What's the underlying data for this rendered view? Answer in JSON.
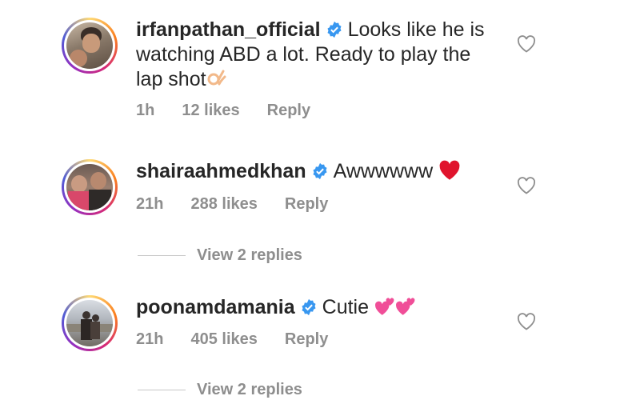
{
  "comments": [
    {
      "username": "irfanpathan_official",
      "text": "Looks like he is watching ABD a lot. Ready to play the lap shot",
      "emoji": "ok-hand-emoji",
      "time": "1h",
      "likes": "12 likes",
      "reply": "Reply"
    },
    {
      "username": "shairaahmedkhan",
      "text": "Awwwwww",
      "emoji": "red-heart-emoji",
      "time": "21h",
      "likes": "288 likes",
      "reply": "Reply",
      "view_replies": "View 2 replies"
    },
    {
      "username": "poonamdamania",
      "text": "Cutie",
      "emoji": "two-hearts-emoji",
      "time": "21h",
      "likes": "405 likes",
      "reply": "Reply",
      "view_replies": "View 2 replies"
    }
  ],
  "colors": {
    "text": "#262626",
    "meta": "#8e8e8e",
    "verified": "#3897f0",
    "heart": "#e0142d",
    "pink": "#f04e98"
  }
}
